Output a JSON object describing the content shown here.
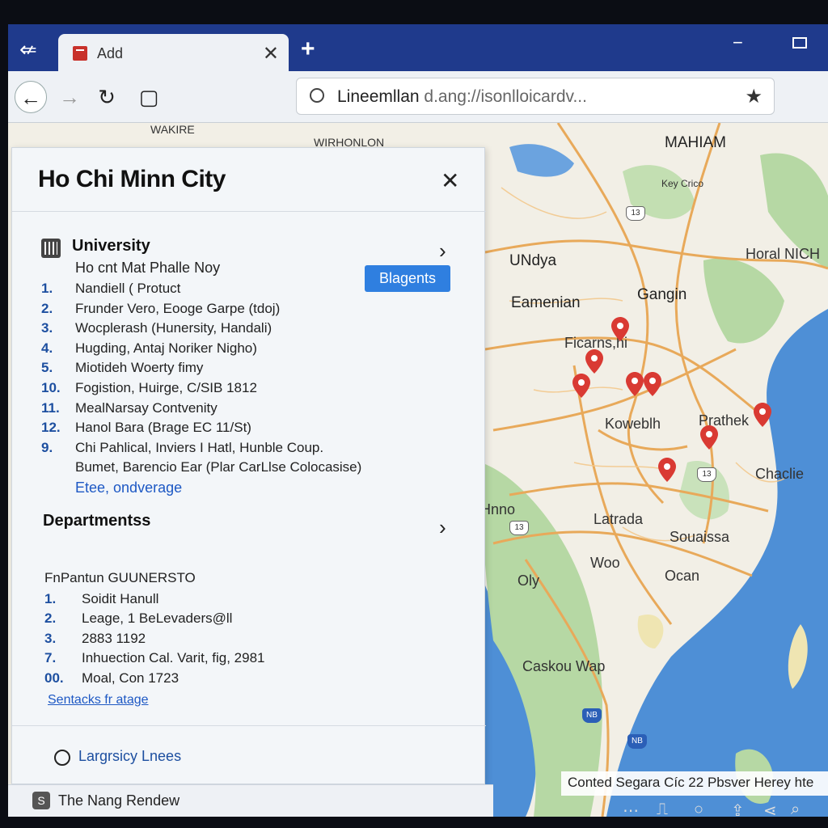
{
  "browser": {
    "tab_title": "Add",
    "tab_close": "✕",
    "new_tab": "+",
    "address_main": "Lineemllan",
    "address_rest": " d.ang://isonlloicardv..."
  },
  "map": {
    "labels": [
      {
        "text": "WAKIRE",
        "cls": "sm"
      },
      {
        "text": "WIRHONLON",
        "cls": "sm"
      },
      {
        "text": "MAHIAM",
        "cls": "lg"
      },
      {
        "text": "Key Crico",
        "cls": "sm"
      },
      {
        "text": "UNdya",
        "cls": "lg"
      },
      {
        "text": "Horal NICH",
        "cls": ""
      },
      {
        "text": "Gangin",
        "cls": "lg"
      },
      {
        "text": "Eamenian",
        "cls": "lg"
      },
      {
        "text": "Ficarns,hi",
        "cls": ""
      },
      {
        "text": "Koweblh",
        "cls": ""
      },
      {
        "text": "Prathek",
        "cls": ""
      },
      {
        "text": "Chaclie",
        "cls": ""
      },
      {
        "text": "Hnno",
        "cls": ""
      },
      {
        "text": "Latrada",
        "cls": ""
      },
      {
        "text": "Souaissa",
        "cls": ""
      },
      {
        "text": "Woo",
        "cls": ""
      },
      {
        "text": "Ocan",
        "cls": ""
      },
      {
        "text": "Oly",
        "cls": ""
      },
      {
        "text": "Caskou Wap",
        "cls": ""
      }
    ],
    "shields": [
      "13",
      "13",
      "13",
      "NB",
      "NB"
    ],
    "footer": "Conted Segara Cíc 22 Pbsver Herey hte"
  },
  "panel": {
    "title": "Ho Chi Minn City",
    "close": "✕",
    "university": {
      "title": "University",
      "subtitle": "Ho cnt Mat Phalle Noy",
      "badge": "Blagents",
      "items": [
        {
          "num": "1.",
          "text": "Nandiell ( Protuct"
        },
        {
          "num": "2.",
          "text": "Frunder Vero, Eooge Garpe (tdoj)"
        },
        {
          "num": "3.",
          "text": "Wocplerash (Hunersity, Handali)"
        },
        {
          "num": "4.",
          "text": "Hugding, Antaj Noriker Nigho)"
        },
        {
          "num": "5.",
          "text": "Miotideh Woerty fimy"
        },
        {
          "num": "10.",
          "text": "Fogistion, Huirge, C/SIB 1812"
        },
        {
          "num": "11.",
          "text": "MealNarsay Contvenity"
        },
        {
          "num": "12.",
          "text": "Hanol Bara (Brage EC 11/St)"
        },
        {
          "num": "9.",
          "text": "Chi Pahlical, Inviers I Hatl, Hunble Coup."
        },
        {
          "num": "",
          "text": "Bumet, Barencio Ear (Plar CarLlse Colocasise)"
        }
      ],
      "link": "Etee, ondverage"
    },
    "departments": {
      "title": "Departmentss",
      "subtitle": "FnPantun GUUNERSTO",
      "items": [
        {
          "num": "1.",
          "text": "Soidit Hanull"
        },
        {
          "num": "2.",
          "text": "Leage, 1 BeLevaders@ll"
        },
        {
          "num": "3.",
          "text": "2883 1192"
        },
        {
          "num": "7.",
          "text": "Inhuection Cal. Varit, fig, 2981"
        },
        {
          "num": "00.",
          "text": "Moal, Con 1723"
        }
      ],
      "link": "Sentacks fr atage"
    },
    "footer_option": "Largrsicy Lnees"
  },
  "statusbar": {
    "text": "The Nang Rendew"
  },
  "colors": {
    "tabbar": "#1f3a8c",
    "badge": "#2f7fe0",
    "pin": "#d93a33",
    "water": "#4e8fd6",
    "forest": "#b6d8a4",
    "road": "#e8a95a"
  }
}
